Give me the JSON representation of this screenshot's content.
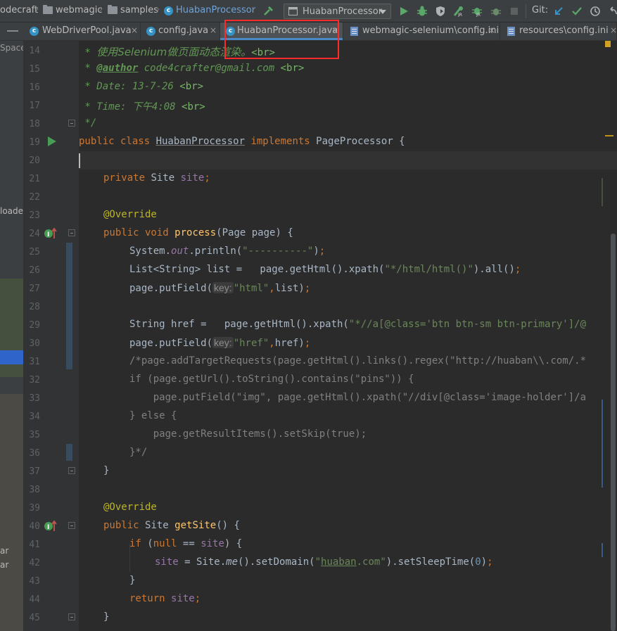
{
  "breadcrumbs": {
    "root": "odecraft",
    "module": "webmagic",
    "package": "samples",
    "file": "HuabanProcessor"
  },
  "toolbar": {
    "run_config": "HuabanProcessor",
    "git_label": "Git:"
  },
  "tabs": [
    {
      "label": "WebDriverPool.java",
      "icon": "class-icon"
    },
    {
      "label": "config.java",
      "icon": "class-icon"
    },
    {
      "label": "HuabanProcessor.java",
      "icon": "class-icon",
      "active": true
    },
    {
      "label": "webmagic-selenium\\config.ini",
      "icon": "ini-file-icon"
    },
    {
      "label": "resources\\config.ini",
      "icon": "ini-file-icon"
    }
  ],
  "sidebar": {
    "space_label": "Space",
    "loader_label": "loade",
    "ar1": "ar",
    "ar2": "ar"
  },
  "line_numbers": [
    "14",
    "15",
    "16",
    "17",
    "18",
    "19",
    "20",
    "21",
    "22",
    "23",
    "24",
    "25",
    "26",
    "27",
    "28",
    "29",
    "30",
    "31",
    "32",
    "33",
    "34",
    "35",
    "36",
    "37",
    "38",
    "39",
    "40",
    "41",
    "42",
    "43",
    "44",
    "45"
  ],
  "code": {
    "l14_star": " * ",
    "l14_text": "使用Selenium做页面动态渲染。",
    "l14_tag": "<br>",
    "l15_star": " * ",
    "l15_author": "@author",
    "l15_text": " code4crafter@gmail.com ",
    "l15_tag": "<br>",
    "l16_text": " * Date: 13-7-26 ",
    "l16_tag": "<br>",
    "l17_text": " * Time: 下午4:08 ",
    "l17_tag": "<br>",
    "l18_text": " */",
    "l19_public": "public class ",
    "l19_name": "HuabanProcessor",
    "l19_impl": " implements ",
    "l19_rest": "PageProcessor {",
    "l21_private": "private ",
    "l21_type": "Site ",
    "l21_field": "site",
    "l21_semi": ";",
    "l23_ann": "@Override",
    "l24_kw": "public void ",
    "l24_mth": "process",
    "l24_rest": "(Page page) {",
    "l25_a": "System.",
    "l25_out": "out",
    "l25_b": ".println(",
    "l25_str": "\"----------\"",
    "l25_c": ")",
    "l25_semi": ";",
    "l26_a": "List<String> list =   page.getHtml().xpath(",
    "l26_str": "\"*/html/html()\"",
    "l26_b": ").all()",
    "l26_semi": ";",
    "l27_a": "page.putField(",
    "l27_hint": "key:",
    "l27_str": "\"html\"",
    "l27_comma": ",",
    "l27_b": "list)",
    "l27_semi": ";",
    "l29_a": "String href =   page.getHtml().xpath(",
    "l29_str": "\"*//a[@class='btn btn-sm btn-primary']/@",
    "l30_a": "page.putField(",
    "l30_hint": "key:",
    "l30_str": "\"href\"",
    "l30_comma": ",",
    "l30_b": "href)",
    "l30_semi": ";",
    "l31": "/*page.addTargetRequests(page.getHtml().links().regex(\"http://huaban\\\\.com/.*",
    "l32": "if (page.getUrl().toString().contains(\"pins\")) {",
    "l33": "    page.putField(\"img\", page.getHtml().xpath(\"//div[@class='image-holder']/a",
    "l34": "} else {",
    "l35": "    page.getResultItems().setSkip(true);",
    "l36": "}*/",
    "l37": "}",
    "l39_ann": "@Override",
    "l40_kw": "public ",
    "l40_type": "Site ",
    "l40_mth": "getSite",
    "l40_rest": "() {",
    "l41_kw": "if ",
    "l41_a": "(",
    "l41_null": "null ",
    "l41_b": "== ",
    "l41_field": "site",
    "l41_c": ") {",
    "l42_field": "site",
    "l42_a": " = Site.",
    "l42_me": "me",
    "l42_b": "().setDomain(",
    "l42_str1": "\"",
    "l42_dom": "huaban",
    "l42_str2": ".com\"",
    "l42_c": ").setSleepTime(",
    "l42_num": "0",
    "l42_d": ")",
    "l42_semi": ";",
    "l43": "}",
    "l44_kw": "return ",
    "l44_field": "site",
    "l44_semi": ";",
    "l45": "}"
  },
  "colors": {
    "keyword": "#cc7832",
    "string": "#6a8759",
    "doc": "#629755",
    "field": "#9876aa",
    "method": "#ffc66d",
    "annotation": "#bbb529",
    "highlight": "#ff2b2b"
  }
}
